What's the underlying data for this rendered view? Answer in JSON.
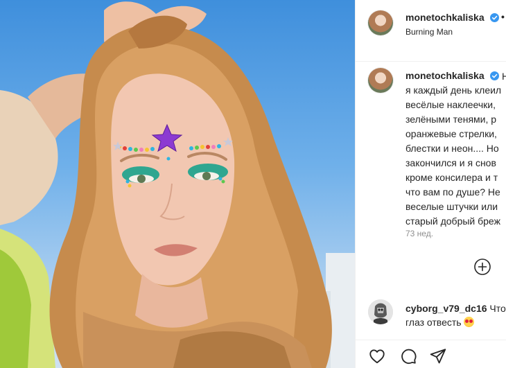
{
  "post": {
    "author": "monetochkaliska",
    "location": "Burning Man"
  },
  "caption": {
    "author": "monetochkaliska",
    "lines": [
      "я каждый день клеил",
      "весёлые наклеечки,",
      "зелёными тенями, р",
      "оранжевые стрелки,",
      "блестки и неон.... Но",
      "закончился и я снов",
      "кроме консилера и т",
      "что вам по душе? Не",
      "веселые штучки или",
      "старый добрый бреж"
    ],
    "first_line_suffix": "Н",
    "time": "73 нед."
  },
  "comments": [
    {
      "author": "cyborg_v79_dc16",
      "text_line1": "Что",
      "text_line2": "глаз отвесть"
    }
  ],
  "icons": {
    "verified": "verified-badge-icon",
    "more": "more-options-icon",
    "add_comment": "plus-circle-icon",
    "like": "heart-icon",
    "comment": "comment-bubble-icon",
    "share": "paper-plane-icon"
  },
  "colors": {
    "verified_blue": "#3897f0",
    "muted_text": "#8e8e8e",
    "border": "#efefef"
  }
}
